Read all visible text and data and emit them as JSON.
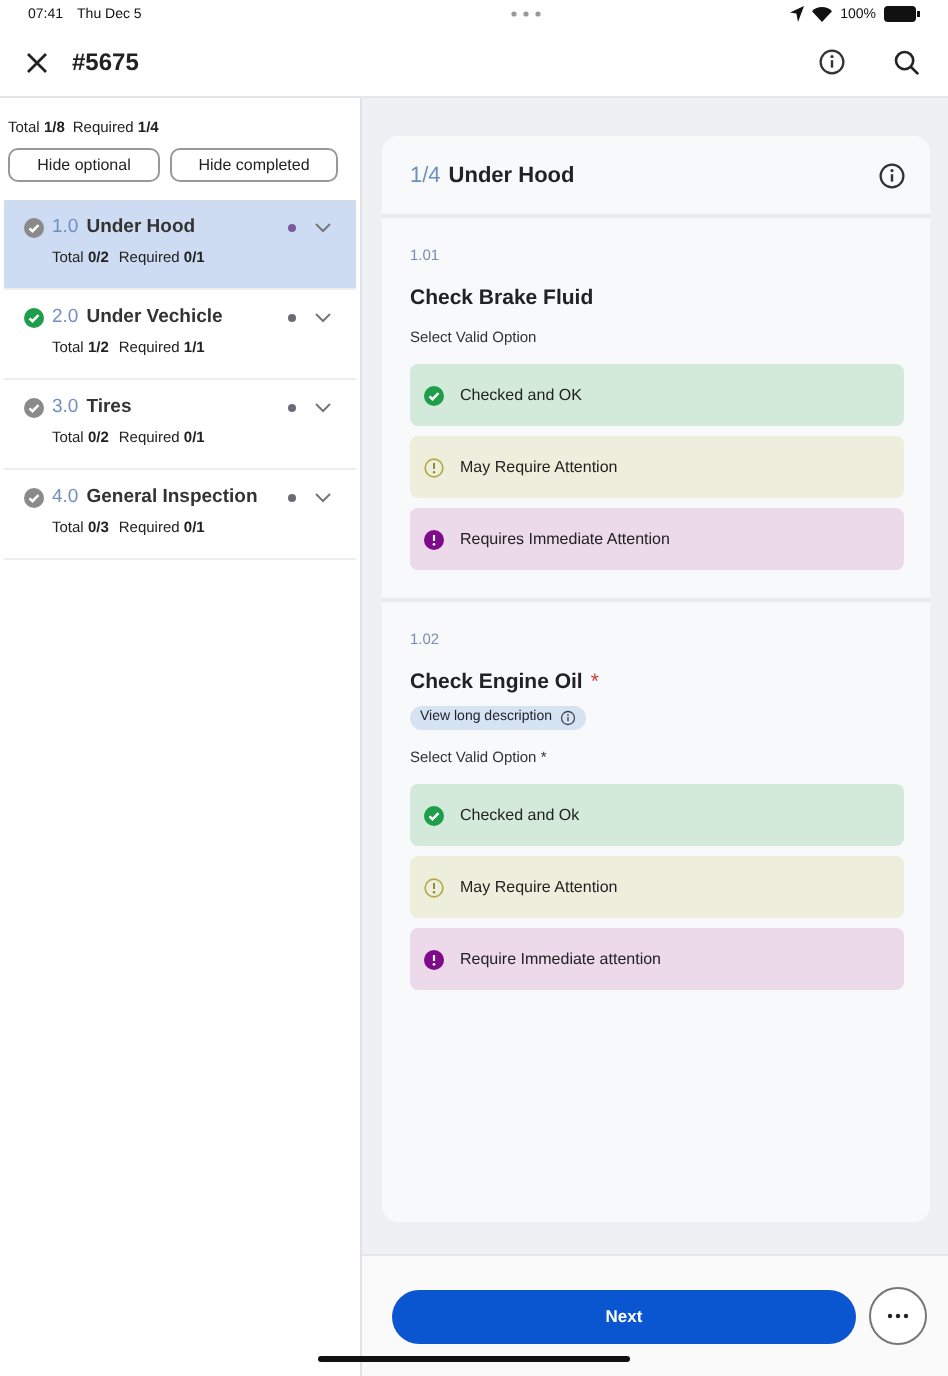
{
  "status_bar": {
    "time": "07:41",
    "date": "Thu Dec 5",
    "battery": "100%"
  },
  "header": {
    "title": "#5675"
  },
  "summary": {
    "total": "Total **1/8**",
    "required": "Required **1/4**"
  },
  "filters": [
    {
      "label": "Hide optional"
    },
    {
      "label": "Hide completed"
    }
  ],
  "sections": [
    {
      "number": "1.0",
      "title": "Under Hood",
      "total": "Total **0/2**",
      "required": "Required **0/1**",
      "completed": false,
      "selected": true,
      "color": "#7a5a9a"
    },
    {
      "number": "2.0",
      "title": "Under Vechicle",
      "total": "Total **1/2**",
      "required": "Required **1/1**",
      "completed": true,
      "selected": false,
      "color": "#6b6b75"
    },
    {
      "number": "3.0",
      "title": "Tires",
      "total": "Total **0/2**",
      "required": "Required **0/1**",
      "completed": false,
      "selected": false,
      "color": "#6b6b75"
    },
    {
      "number": "4.0",
      "title": "General Inspection",
      "total": "Total **0/3**",
      "required": "Required **0/1**",
      "completed": false,
      "selected": false,
      "color": "#6b6b75"
    }
  ],
  "card": {
    "position": "1/4",
    "title": "Under Hood",
    "questions": [
      {
        "number": "1.01",
        "title": "Check Brake Fluid",
        "prompt": "Select Valid Option",
        "options": [
          {
            "kind": "ok",
            "label": "Checked and OK"
          },
          {
            "kind": "warning",
            "label": "May Require Attention"
          },
          {
            "kind": "critical",
            "label": "Requires Immediate Attention"
          }
        ]
      },
      {
        "number": "1.02",
        "title": "Check Engine Oil",
        "required_mark": "*",
        "description_link": "View long description",
        "prompt": "Select Valid Option *",
        "options": [
          {
            "kind": "ok",
            "label": "Checked and Ok"
          },
          {
            "kind": "warning",
            "label": "May Require Attention"
          },
          {
            "kind": "critical",
            "label": "Require Immediate attention"
          }
        ]
      }
    ]
  },
  "footer": {
    "primary": "Next"
  }
}
